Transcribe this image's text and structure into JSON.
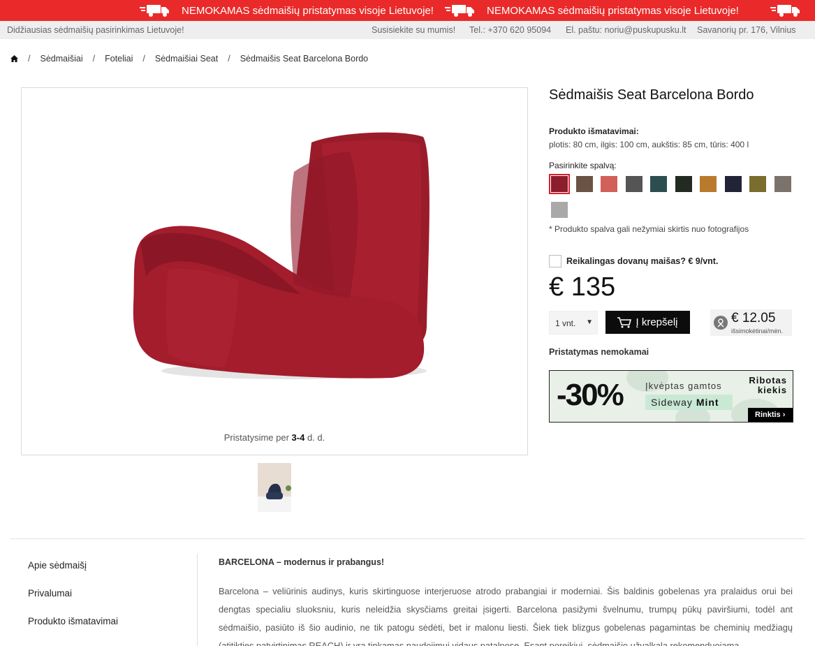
{
  "promo": {
    "items": [
      {
        "text": "NEMOKAMAS sėdmaišių pristatymas visoje Lietuvoje!"
      },
      {
        "text": "NEMOKAMAS sėdmaišių pristatymas visoje Lietuvoje!"
      }
    ],
    "icon": "delivery-truck-icon"
  },
  "infobar": {
    "tagline": "Didžiausias sėdmaišių pasirinkimas Lietuvoje!",
    "contact": "Susisiekite su mumis!",
    "phone": "Tel.: +370 620 95094",
    "email": "El. paštu: noriu@puskupusku.lt",
    "address": "Savanorių pr. 176, Vilnius"
  },
  "breadcrumb": {
    "home_icon": "home-icon",
    "items": [
      "Sėdmaišiai",
      "Foteliai",
      "Sėdmaišiai Seat",
      "Sėdmaišis Seat Barcelona Bordo"
    ]
  },
  "gallery": {
    "delivery_prefix": "Pristatysime per ",
    "delivery_days": "3-4",
    "delivery_suffix": " d. d."
  },
  "product": {
    "title": "Sėdmaišis Seat Barcelona Bordo",
    "dims_label": "Produkto išmatavimai:",
    "dims_value": "plotis: 80 cm, ilgis: 100 cm, aukštis: 85 cm, tūris: 400 l",
    "color_label": "Pasirinkite spalvą:",
    "swatches": [
      "#8b1d2c",
      "#6b5344",
      "#d2605a",
      "#555555",
      "#2d4e4f",
      "#222a22",
      "#b97a2d",
      "#232338",
      "#7a6d2e",
      "#7b736b",
      "#a9a9a9"
    ],
    "active_swatch": 0,
    "color_note": "* Produkto spalva gali nežymiai skirtis nuo fotografijos",
    "gift_label": "Reikalingas dovanų maišas? € 9/vnt.",
    "price": "€ 135",
    "qty_value": "1 vnt.",
    "cart_label": "Į krepšelį",
    "installment_amount": "€ 12.05",
    "installment_sub": "išsimokėtinai/mėn.",
    "shipping": "Pristatymas nemokamai"
  },
  "banner": {
    "discount": "-30%",
    "inspired": "Įkvėptas gamtos",
    "collection_prefix": "Sideway ",
    "collection_bold": "Mint",
    "limited_line1": "Ribotas",
    "limited_line2": "kiekis",
    "cta": "Rinktis"
  },
  "sidenav": {
    "items": [
      "Apie sėdmaišį",
      "Privalumai",
      "Produkto išmatavimai"
    ]
  },
  "description": {
    "title": "BARCELONA – modernus ir prabangus!",
    "body": "Barcelona – veliūrinis audinys, kuris skirtinguose interjeruose atrodo prabangiai ir moderniai. Šis baldinis gobelenas yra pralaidus orui bei dengtas specialiu sluoksniu, kuris neleidžia skysčiams greitai įsigerti. Barcelona pasižymi švelnumu, trumpų pūkų paviršiumi, todėl ant sėdmaišio, pasiūto iš šio audinio, ne tik patogu sėdėti, bet ir malonu liesti. Šiek tiek blizgus gobelenas pagamintas be cheminių medžiagų (atitikties patvirtinimas REACH) ir yra tinkamas naudojimui vidaus patalpose. Esant poreikiui, sėdmaišio užvalkala rekomenduojama"
  }
}
